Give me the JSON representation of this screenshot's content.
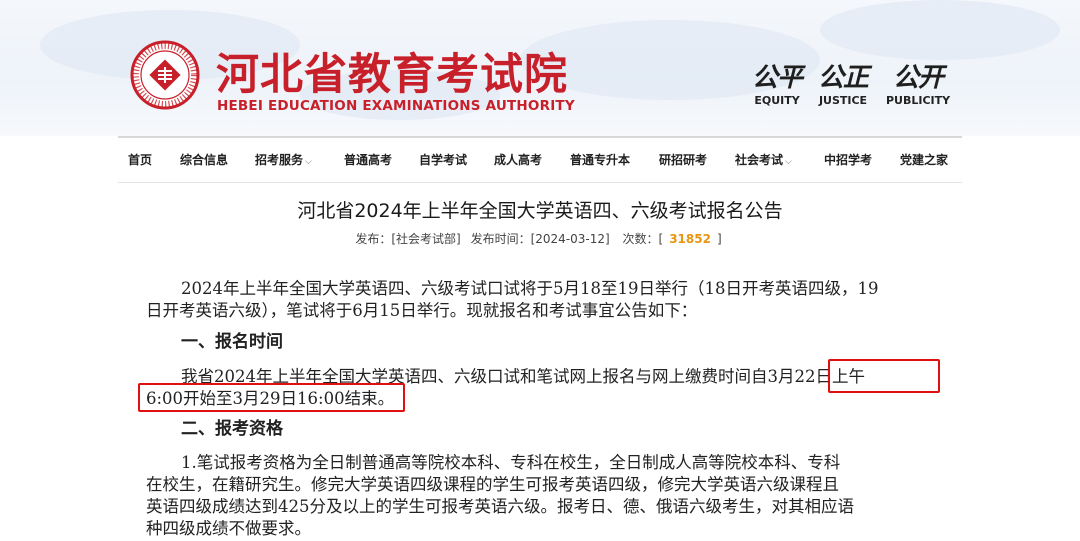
{
  "header": {
    "title": "河北省教育考试院",
    "subtitle": "HEBEI EDUCATION EXAMINATIONS AUTHORITY",
    "logo_icon": "seal-logo-icon",
    "mottos": [
      {
        "cn": "公平",
        "en": "EQUITY"
      },
      {
        "cn": "公正",
        "en": "JUSTICE"
      },
      {
        "cn": "公开",
        "en": "PUBLICITY"
      }
    ]
  },
  "nav": {
    "items": [
      {
        "label": "首页"
      },
      {
        "label": "综合信息"
      },
      {
        "label": "招考服务",
        "dropdown": true
      },
      {
        "label": "普通高考"
      },
      {
        "label": "自学考试"
      },
      {
        "label": "成人高考"
      },
      {
        "label": "普通专升本"
      },
      {
        "label": "研招研考"
      },
      {
        "label": "社会考试",
        "dropdown": true
      },
      {
        "label": "中招学考"
      },
      {
        "label": "党建之家"
      }
    ],
    "chevron_icon": "chevron-down-icon"
  },
  "article": {
    "title": "河北省2024年上半年全国大学英语四、六级考试报名公告",
    "meta": {
      "publisher": "发布：[社会考试部]",
      "time": "发布时间：[2024-03-12]",
      "views_label": "次数：[",
      "views_value": "31852",
      "views_end": "]"
    },
    "intro_line1": "2024年上半年全国大学英语四、六级考试口试将于5月18至19日举行（18日开考英语四级，19",
    "intro_line2": "日开考英语六级），笔试将于6月15日举行。现就报名和考试事宜公告如下：",
    "section1": "一、报名时间",
    "s1_line1_a": "我省2024年上半年全国大学英语四、六级口试和笔试网上报名与网上缴费时间自",
    "s1_line1_b": "3月22日上午",
    "s1_line2": "6:00开始至3月29日16:00结束。",
    "section2": "二、报考资格",
    "s2_line1": "1.笔试报考资格为全日制普通高等院校本科、专科在校生，全日制成人高等院校本科、专科",
    "s2_line2": "在校生，在籍研究生。修完大学英语四级课程的学生可报考英语四级，修完大学英语六级课程且",
    "s2_line3": "英语四级成绩达到425分及以上的学生可报考英语六级。报考日、德、俄语六级考生，对其相应语",
    "s2_line4": "种四级成绩不做要求。"
  },
  "colors": {
    "brand_red": "#c8202a",
    "highlight_red": "#e01010",
    "views_orange": "#e8950f"
  }
}
